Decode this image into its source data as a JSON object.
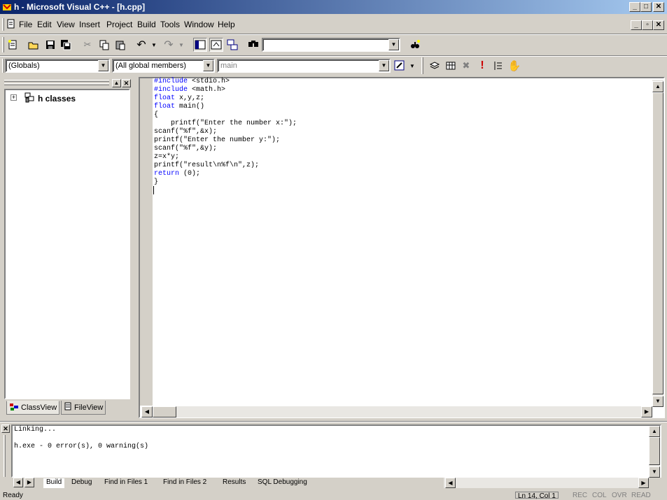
{
  "window": {
    "title": "h - Microsoft Visual C++ - [h.cpp]",
    "minimize": "_",
    "maximize": "□",
    "close": "✕",
    "doc_minimize": "_",
    "doc_restore": "▫",
    "doc_close": "✕"
  },
  "menu": [
    "File",
    "Edit",
    "View",
    "Insert",
    "Project",
    "Build",
    "Tools",
    "Window",
    "Help"
  ],
  "toolbar": {
    "find_value": "",
    "wizard": {
      "globals": "(Globals)",
      "members": "(All global members)",
      "function": "main"
    }
  },
  "classview": {
    "root": "h classes",
    "tabs": [
      "ClassView",
      "FileView"
    ]
  },
  "editor": {
    "lines": [
      {
        "kw": "#include",
        "rest": " <stdio.h>"
      },
      {
        "kw": "#include",
        "rest": " <math.h>"
      },
      {
        "kw": "float",
        "rest": " x,y,z;"
      },
      {
        "kw": "float",
        "rest": " main()"
      },
      {
        "kw": "",
        "rest": "{"
      },
      {
        "kw": "",
        "rest": "    printf(\"Enter the number x:\");"
      },
      {
        "kw": "",
        "rest": "scanf(\"%f\",&x);"
      },
      {
        "kw": "",
        "rest": "printf(\"Enter the number y:\");"
      },
      {
        "kw": "",
        "rest": "scanf(\"%f\",&y);"
      },
      {
        "kw": "",
        "rest": "z=x*y;"
      },
      {
        "kw": "",
        "rest": "printf(\"result\\n%f\\n\",z);"
      },
      {
        "kw": "return",
        "rest": " (0);"
      },
      {
        "kw": "",
        "rest": "}"
      }
    ]
  },
  "output": {
    "line1": "Linking...",
    "line2": "",
    "line3": "h.exe - 0 error(s), 0 warning(s)",
    "tabs": [
      "Build",
      "Debug",
      "Find in Files 1",
      "Find in Files 2",
      "Results",
      "SQL Debugging"
    ]
  },
  "status": {
    "text": "Ready",
    "position": "Ln 14, Col 1",
    "indicators": [
      "REC",
      "COL",
      "OVR",
      "READ"
    ]
  },
  "colors": {
    "keyword": "#0000ff",
    "title_start": "#0a246a",
    "title_end": "#a6caf0",
    "face": "#d4d0c8"
  }
}
